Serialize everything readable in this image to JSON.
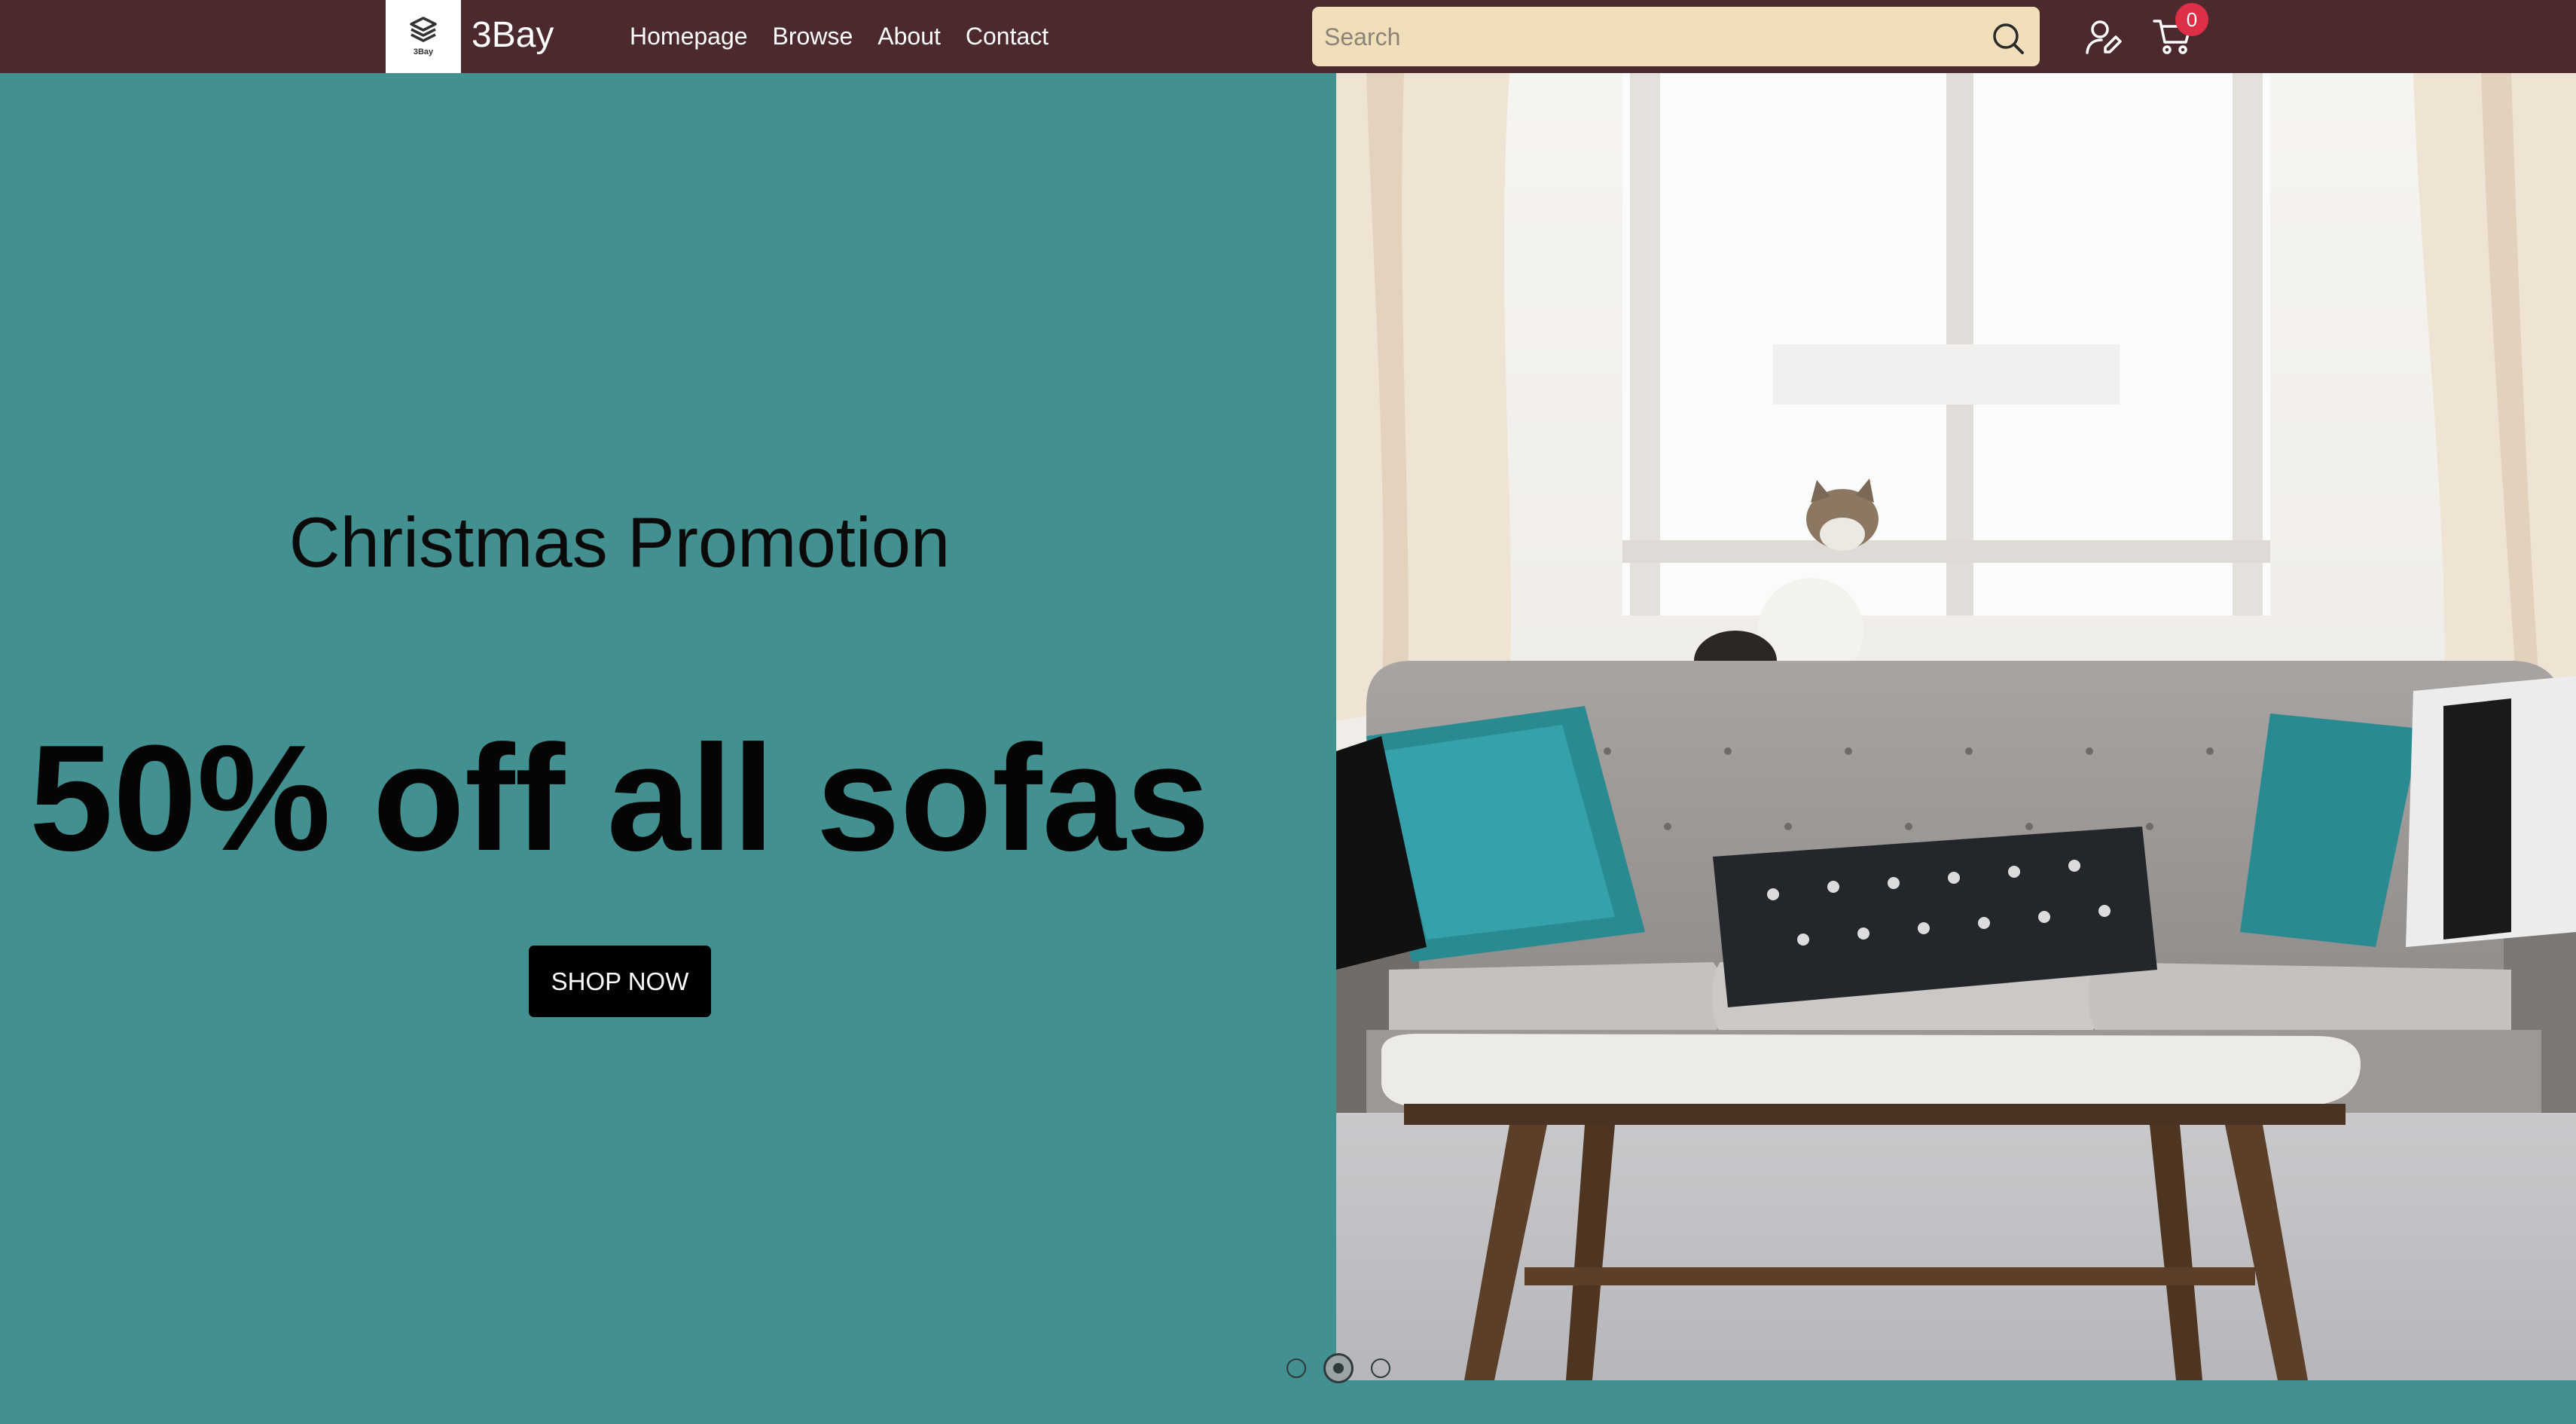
{
  "brand": {
    "name": "3Bay",
    "logo_text": "3Bay"
  },
  "nav": {
    "items": [
      {
        "label": "Homepage"
      },
      {
        "label": "Browse"
      },
      {
        "label": "About"
      },
      {
        "label": "Contact"
      }
    ]
  },
  "search": {
    "placeholder": "Search",
    "value": ""
  },
  "cart": {
    "count": "0"
  },
  "hero": {
    "promo_title": "Christmas Promotion",
    "headline": "50% off all sofas",
    "cta_label": "SHOP NOW",
    "slide_count": 3,
    "active_slide": 2
  },
  "icons": {
    "logo": "layers-icon",
    "search": "search-icon",
    "user": "user-edit-icon",
    "cart": "cart-icon"
  },
  "colors": {
    "header_bg": "#4b292d",
    "hero_bg": "#42908f",
    "search_bg": "#f1dfbb",
    "badge_bg": "#dd2f45",
    "button_bg": "#000000"
  }
}
